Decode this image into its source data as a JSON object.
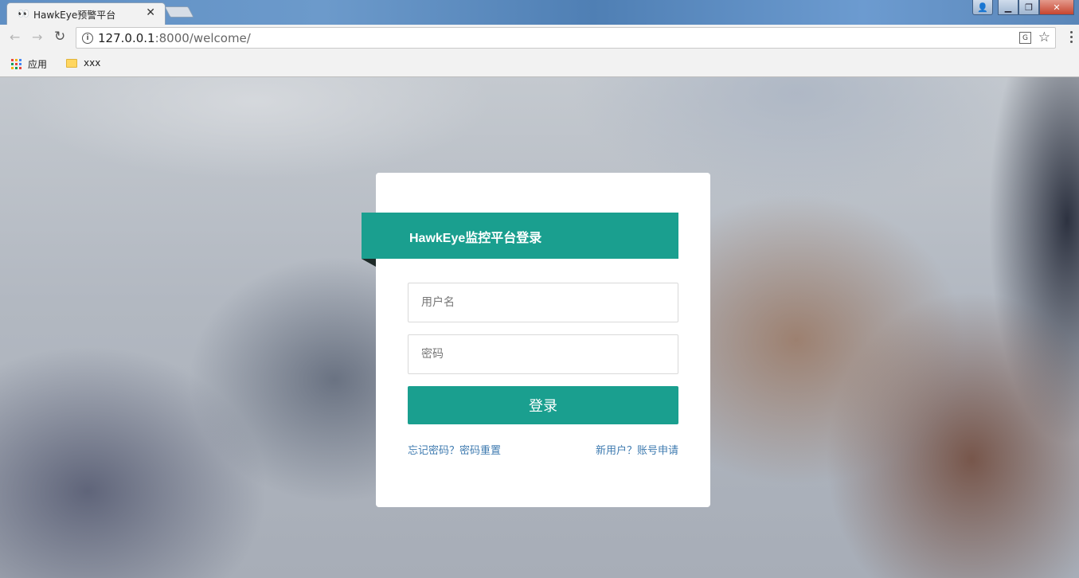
{
  "browser": {
    "tab": {
      "title": "HawkEye预警平台",
      "icon": "eyes-icon",
      "close_glyph": "✕"
    },
    "address": {
      "host": "127.0.0.1",
      "rest": ":8000/welcome/"
    },
    "bookmarks": [
      {
        "label": "应用",
        "icon": "apps-grid-icon"
      },
      {
        "label": "xxx",
        "icon": "folder-icon"
      }
    ],
    "icons": {
      "back": "back-arrow-icon",
      "forward": "forward-arrow-icon",
      "reload": "reload-icon",
      "info": "info-icon",
      "translate": "translate-icon",
      "star": "bookmark-star-icon",
      "menu": "menu-dots-icon"
    }
  },
  "login": {
    "title": "HawkEye监控平台登录",
    "username_placeholder": "用户名",
    "password_placeholder": "密码",
    "submit_label": "登录",
    "forgot_link": "忘记密码？密码重置",
    "register_link": "新用户？账号申请"
  },
  "colors": {
    "accent": "#1a9f8f",
    "link": "#3f7bb0"
  }
}
